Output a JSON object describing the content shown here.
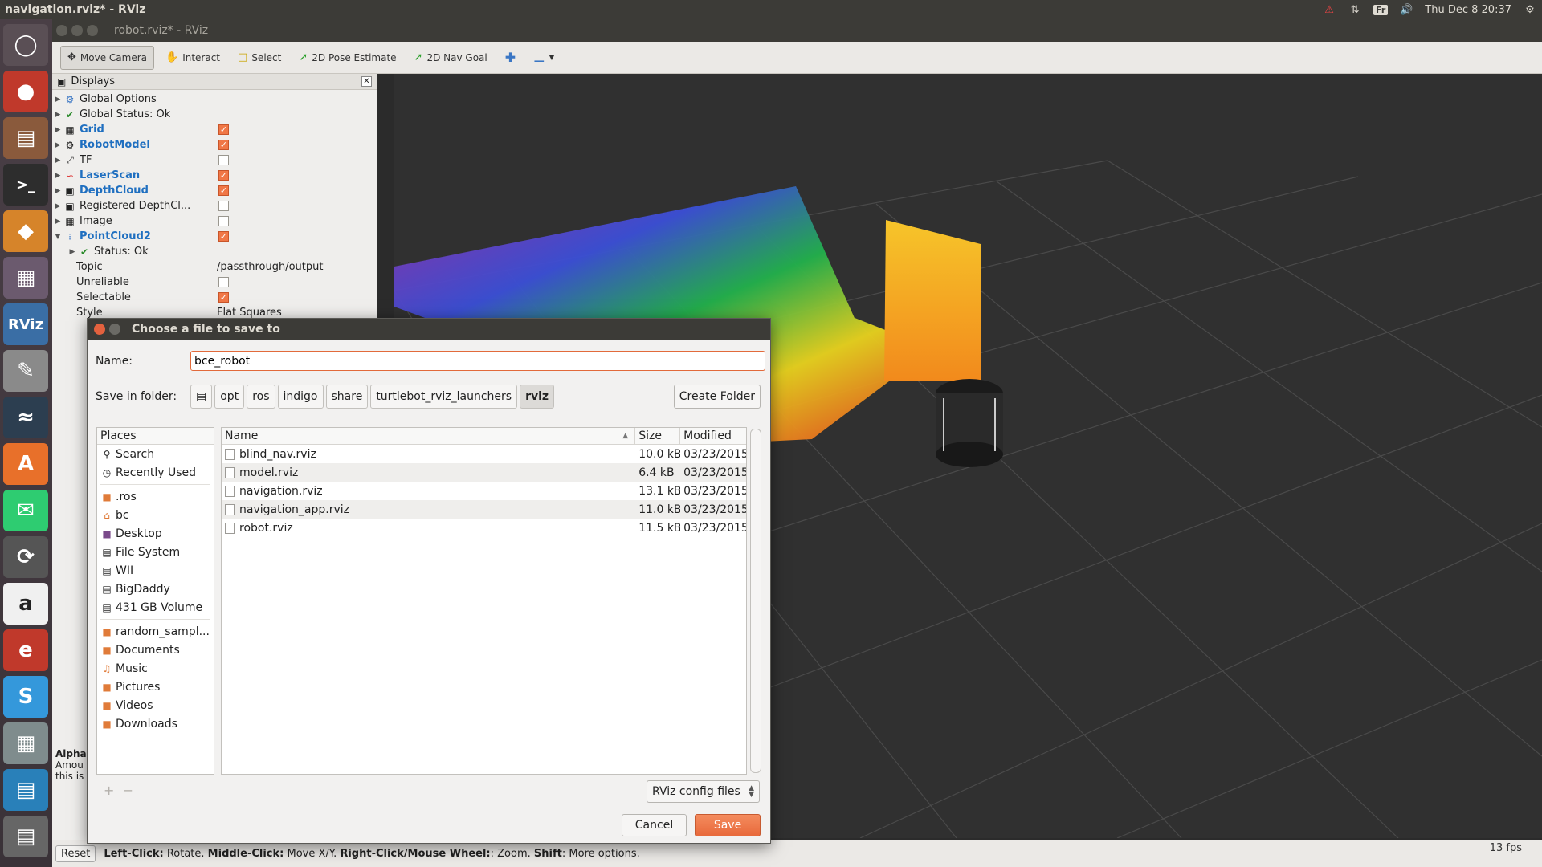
{
  "top_panel": {
    "title": "navigation.rviz* - RViz",
    "keyboard": "Fr",
    "clock": "Thu Dec  8 20:37"
  },
  "window": {
    "title": "robot.rviz* - RViz"
  },
  "toolbar": {
    "move_camera": "Move Camera",
    "interact": "Interact",
    "select": "Select",
    "pose_estimate": "2D Pose Estimate",
    "nav_goal": "2D Nav Goal"
  },
  "displays": {
    "header": "Displays",
    "items": [
      {
        "label": "Global Options"
      },
      {
        "label": "Global Status: Ok"
      },
      {
        "label": "Grid"
      },
      {
        "label": "RobotModel"
      },
      {
        "label": "TF"
      },
      {
        "label": "LaserScan"
      },
      {
        "label": "DepthCloud"
      },
      {
        "label": "Registered DepthCl..."
      },
      {
        "label": "Image"
      },
      {
        "label": "PointCloud2"
      },
      {
        "label": "Status: Ok"
      },
      {
        "label": "Topic",
        "value": "/passthrough/output"
      },
      {
        "label": "Unreliable"
      },
      {
        "label": "Selectable"
      },
      {
        "label": "Style",
        "value": "Flat Squares"
      }
    ],
    "desc_title": "Alpha",
    "desc_line1": "Amou",
    "desc_line2": "this is"
  },
  "statusbar": {
    "reset": "Reset",
    "help_prefix": "Left-Click:",
    "help_1": " Rotate. ",
    "help_mid": "Middle-Click:",
    "help_2": " Move X/Y. ",
    "help_right": "Right-Click/Mouse Wheel:",
    "help_3": ": Zoom. ",
    "help_shift": "Shift",
    "help_4": ": More options.",
    "fps": "13 fps"
  },
  "dialog": {
    "title": "Choose a file to save to",
    "name_label": "Name:",
    "name_value": "bce_robot",
    "folder_label": "Save in folder:",
    "crumbs": [
      "opt",
      "ros",
      "indigo",
      "share",
      "turtlebot_rviz_launchers",
      "rviz"
    ],
    "create_folder": "Create Folder",
    "places_header": "Places",
    "places": [
      "Search",
      "Recently Used",
      ".ros",
      "bc",
      "Desktop",
      "File System",
      "WII",
      "BigDaddy",
      "431 GB Volume",
      "random_sampl...",
      "Documents",
      "Music",
      "Pictures",
      "Videos",
      "Downloads"
    ],
    "columns": {
      "name": "Name",
      "size": "Size",
      "modified": "Modified"
    },
    "files": [
      {
        "name": "blind_nav.rviz",
        "size": "10.0 kB",
        "modified": "03/23/2015"
      },
      {
        "name": "model.rviz",
        "size": "6.4 kB",
        "modified": "03/23/2015"
      },
      {
        "name": "navigation.rviz",
        "size": "13.1 kB",
        "modified": "03/23/2015"
      },
      {
        "name": "navigation_app.rviz",
        "size": "11.0 kB",
        "modified": "03/23/2015"
      },
      {
        "name": "robot.rviz",
        "size": "11.5 kB",
        "modified": "03/23/2015"
      }
    ],
    "filter": "RViz config files",
    "cancel": "Cancel",
    "save": "Save"
  },
  "colors": {
    "accent": "#e8693b",
    "link_blue": "#1f6fc0",
    "panel_dark": "#3c3b37"
  }
}
